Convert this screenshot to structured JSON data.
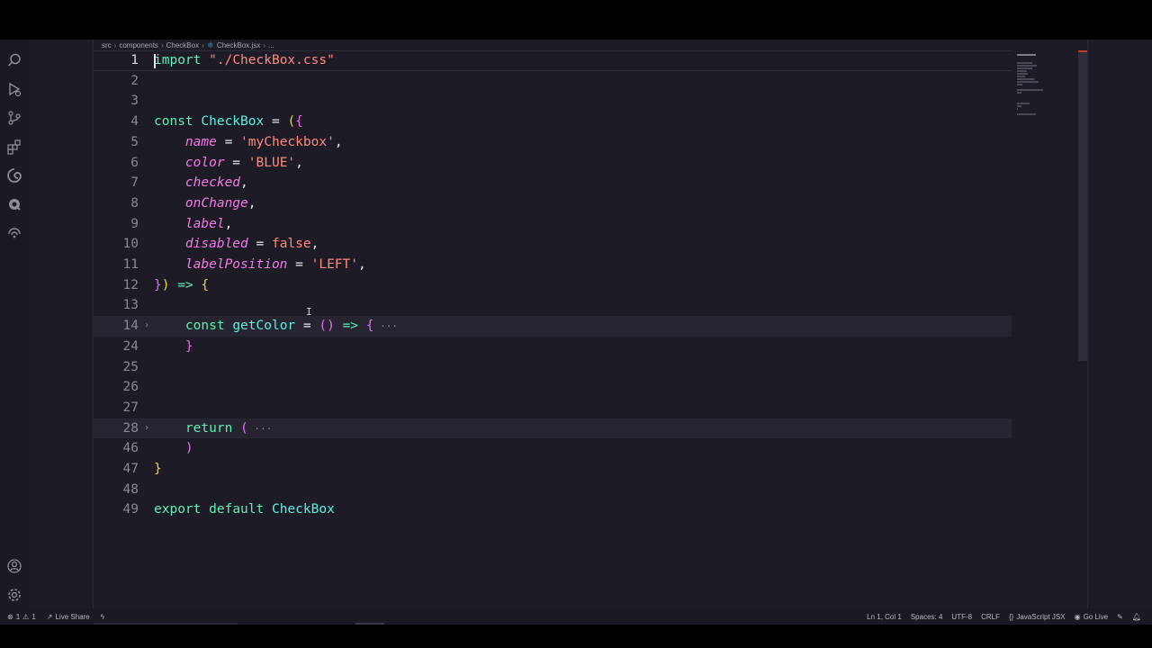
{
  "breadcrumb": {
    "items": [
      "src",
      "components",
      "CheckBox",
      "CheckBox.jsx",
      "..."
    ]
  },
  "icons": {
    "activity_top": [
      "search-icon",
      "run-debug-icon",
      "source-control-icon",
      "extensions-icon",
      "edge-icon",
      "quokka-icon",
      "remote-icon"
    ],
    "activity_bottom": [
      "account-icon",
      "settings-gear-icon"
    ]
  },
  "code_lines": [
    {
      "n": "1",
      "tokens": [
        [
          "kw",
          "import"
        ],
        [
          "op",
          " "
        ],
        [
          "str",
          "\"./CheckBox.css\""
        ]
      ]
    },
    {
      "n": "2",
      "tokens": []
    },
    {
      "n": "3",
      "tokens": []
    },
    {
      "n": "4",
      "tokens": [
        [
          "kw",
          "const"
        ],
        [
          "op",
          " "
        ],
        [
          "fn",
          "CheckBox"
        ],
        [
          "op",
          " = "
        ],
        [
          "p1",
          "("
        ],
        [
          "p2",
          "{"
        ]
      ]
    },
    {
      "n": "5",
      "tokens": [
        [
          "op",
          "    "
        ],
        [
          "param",
          "name"
        ],
        [
          "op",
          " = "
        ],
        [
          "str",
          "'myCheckbox'"
        ],
        [
          "op",
          ","
        ]
      ]
    },
    {
      "n": "6",
      "tokens": [
        [
          "op",
          "    "
        ],
        [
          "param",
          "color"
        ],
        [
          "op",
          " = "
        ],
        [
          "str",
          "'BLUE'"
        ],
        [
          "op",
          ","
        ]
      ]
    },
    {
      "n": "7",
      "tokens": [
        [
          "op",
          "    "
        ],
        [
          "param",
          "checked"
        ],
        [
          "op",
          ","
        ]
      ]
    },
    {
      "n": "8",
      "tokens": [
        [
          "op",
          "    "
        ],
        [
          "param",
          "onChange"
        ],
        [
          "op",
          ","
        ]
      ]
    },
    {
      "n": "9",
      "tokens": [
        [
          "op",
          "    "
        ],
        [
          "param",
          "label"
        ],
        [
          "op",
          ","
        ]
      ]
    },
    {
      "n": "10",
      "tokens": [
        [
          "op",
          "    "
        ],
        [
          "param",
          "disabled"
        ],
        [
          "op",
          " = "
        ],
        [
          "bool",
          "false"
        ],
        [
          "op",
          ","
        ]
      ]
    },
    {
      "n": "11",
      "tokens": [
        [
          "op",
          "    "
        ],
        [
          "param",
          "labelPosition"
        ],
        [
          "op",
          " = "
        ],
        [
          "str",
          "'LEFT'"
        ],
        [
          "op",
          ","
        ]
      ]
    },
    {
      "n": "12",
      "tokens": [
        [
          "p2",
          "}"
        ],
        [
          "p1",
          ")"
        ],
        [
          "op",
          " "
        ],
        [
          "kw",
          "=>"
        ],
        [
          "op",
          " "
        ],
        [
          "p1",
          "{"
        ]
      ]
    },
    {
      "n": "13",
      "tokens": []
    },
    {
      "n": "14",
      "fold": "›",
      "folded": true,
      "tokens": [
        [
          "op",
          "    "
        ],
        [
          "kw",
          "const"
        ],
        [
          "op",
          " "
        ],
        [
          "fn",
          "getColor"
        ],
        [
          "op",
          " = "
        ],
        [
          "p2",
          "()"
        ],
        [
          "op",
          " "
        ],
        [
          "kw",
          "=>"
        ],
        [
          "op",
          " "
        ],
        [
          "p2",
          "{"
        ],
        [
          "ell",
          " ···"
        ]
      ]
    },
    {
      "n": "24",
      "tokens": [
        [
          "op",
          "    "
        ],
        [
          "p2",
          "}"
        ]
      ]
    },
    {
      "n": "25",
      "tokens": []
    },
    {
      "n": "26",
      "tokens": []
    },
    {
      "n": "27",
      "tokens": []
    },
    {
      "n": "28",
      "fold": "›",
      "folded": true,
      "tokens": [
        [
          "op",
          "    "
        ],
        [
          "kw",
          "return"
        ],
        [
          "op",
          " "
        ],
        [
          "p2",
          "("
        ],
        [
          "ell",
          " ···"
        ]
      ]
    },
    {
      "n": "46",
      "tokens": [
        [
          "op",
          "    "
        ],
        [
          "p2",
          ")"
        ]
      ]
    },
    {
      "n": "47",
      "tokens": [
        [
          "p1",
          "}"
        ]
      ]
    },
    {
      "n": "48",
      "tokens": []
    },
    {
      "n": "49",
      "tokens": [
        [
          "kw",
          "export"
        ],
        [
          "op",
          " "
        ],
        [
          "kw",
          "default"
        ],
        [
          "op",
          " "
        ],
        [
          "fn",
          "CheckBox"
        ]
      ]
    }
  ],
  "status": {
    "errors": "1",
    "warnings": "1",
    "live_share": "Live Share",
    "position": "Ln 1, Col 1",
    "spaces": "Spaces: 4",
    "encoding": "UTF-8",
    "eol": "CRLF",
    "language": "JavaScript JSX",
    "go_live": "Go Live"
  },
  "colors": {
    "background": "#1d1b26",
    "keyword": "#5ef0b4",
    "string": "#ff8a80",
    "param": "#f57ae6",
    "bracket1": "#f5d04a",
    "bracket2": "#e86bf0"
  }
}
